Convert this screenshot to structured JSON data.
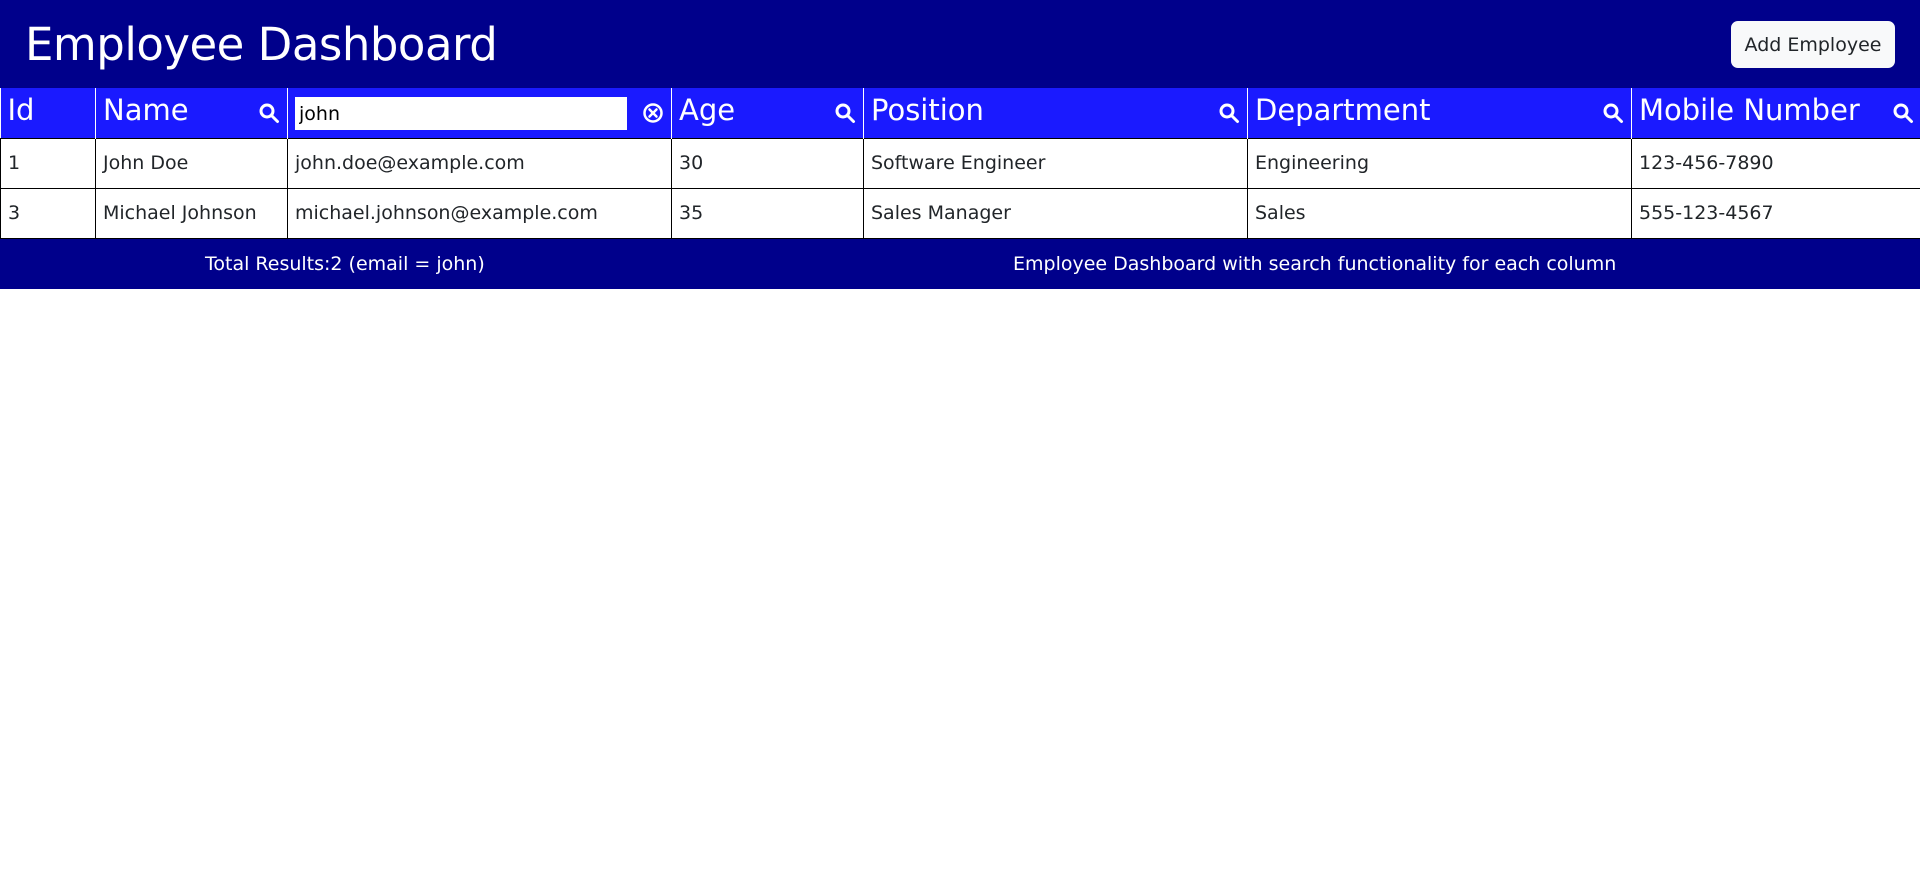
{
  "app": {
    "title": "Employee Dashboard",
    "add_button_label": "Add Employee"
  },
  "table": {
    "columns": [
      {
        "key": "id",
        "label": "Id",
        "searchable": false
      },
      {
        "key": "name",
        "label": "Name",
        "searchable": true,
        "icon": "search-icon"
      },
      {
        "key": "email",
        "label": "",
        "search_value": "john",
        "searchable": true,
        "icon": "clear-icon"
      },
      {
        "key": "age",
        "label": "Age",
        "searchable": true,
        "icon": "search-icon"
      },
      {
        "key": "position",
        "label": "Position",
        "searchable": true,
        "icon": "search-icon"
      },
      {
        "key": "department",
        "label": "Department",
        "searchable": true,
        "icon": "search-icon"
      },
      {
        "key": "mobile",
        "label": "Mobile Number",
        "searchable": true,
        "icon": "search-icon"
      }
    ],
    "rows": [
      {
        "id": "1",
        "name": "John Doe",
        "email": "john.doe@example.com",
        "age": "30",
        "position": "Software Engineer",
        "department": "Engineering",
        "mobile": "123-456-7890"
      },
      {
        "id": "3",
        "name": "Michael Johnson",
        "email": "michael.johnson@example.com",
        "age": "35",
        "position": "Sales Manager",
        "department": "Sales",
        "mobile": "555-123-4567"
      }
    ]
  },
  "footer": {
    "results_text": "Total Results:2 (email = john)",
    "description": "Employee Dashboard with search functionality for each column"
  },
  "colors": {
    "navy": "#00008b",
    "header_blue": "#1a1aff",
    "button_bg": "#f8f9fa"
  }
}
